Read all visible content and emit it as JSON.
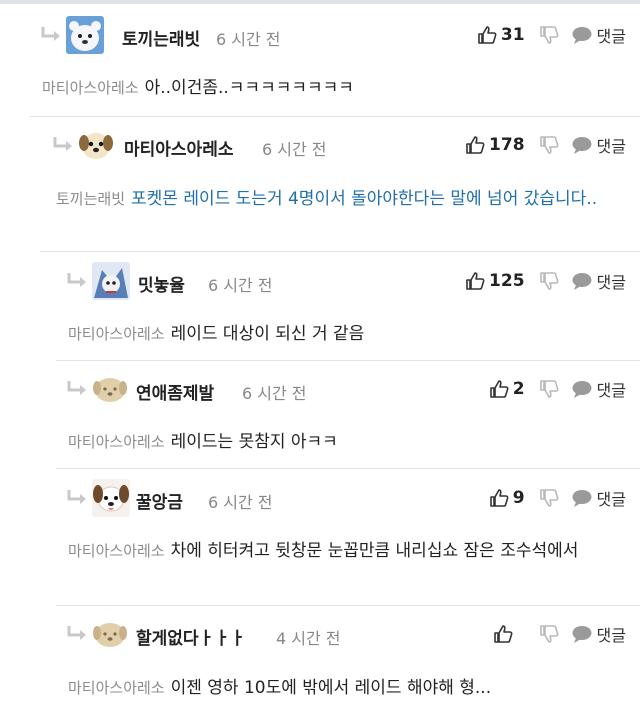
{
  "reply_label": "댓글",
  "colors": {
    "link": "#1f6fa8",
    "mention": "#8c8c8c",
    "divider": "#e3e3e3"
  },
  "comments": [
    {
      "username": "토끼는래빗",
      "time": "6 시간 전",
      "likes": "31",
      "mention": "마티아스아레소",
      "text": "아..이건좀..ㅋㅋㅋㅋㅋㅋㅋㅋ",
      "avatar": "white-bear-avatar"
    },
    {
      "username": "마티아스아레소",
      "time": "6 시간 전",
      "likes": "178",
      "mention": "토끼는래빗",
      "text": "포켓몬 레이드 도는거 4명이서 돌아야한다는 말에 넘어 갔습니다..",
      "avatar": "puppy-avatar"
    },
    {
      "username": "밋놓율",
      "time": "6 시간 전",
      "likes": "125",
      "mention": "마티아스아레소",
      "text": "레이드 대상이 되신 거 같음",
      "avatar": "cartoon-avatar"
    },
    {
      "username": "연애좀제발",
      "time": "6 시간 전",
      "likes": "2",
      "mention": "마티아스아레소",
      "text": "레이드는 못참지 아ㅋㅋ",
      "avatar": "default-dog-avatar"
    },
    {
      "username": "꿀앙금",
      "time": "6 시간 전",
      "likes": "9",
      "mention": "마티아스아레소",
      "text": "차에 히터켜고 뒷창문 눈꼽만큼 내리십쇼 잠은 조수석에서",
      "avatar": "dog-face-avatar"
    },
    {
      "username": "할게없다ㅏㅏㅏ",
      "time": "4 시간 전",
      "likes": "",
      "mention": "마티아스아레소",
      "text": "이젠 영하 10도에 밖에서 레이드 해야해 형...",
      "avatar": "default-dog-avatar"
    }
  ]
}
